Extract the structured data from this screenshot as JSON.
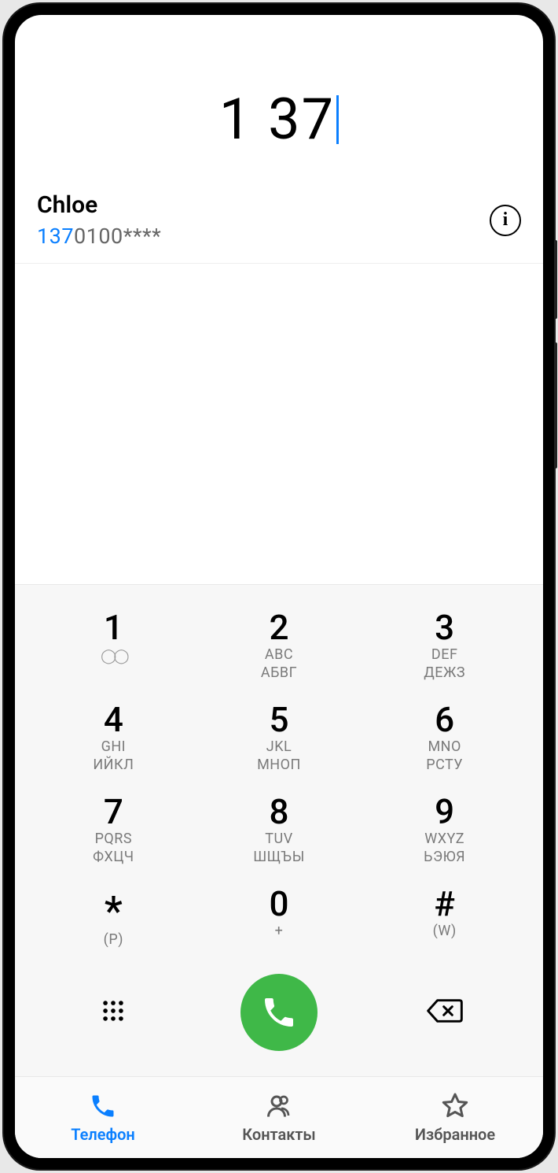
{
  "dialed_number": "1 37",
  "suggestion": {
    "name": "Chloe",
    "number_match": "137",
    "number_rest": "0100****"
  },
  "keys": [
    {
      "digit": "1",
      "sub1": "",
      "sub2": "",
      "voicemail": true
    },
    {
      "digit": "2",
      "sub1": "ABC",
      "sub2": "АБВГ"
    },
    {
      "digit": "3",
      "sub1": "DEF",
      "sub2": "ДЕЖЗ"
    },
    {
      "digit": "4",
      "sub1": "GHI",
      "sub2": "ИЙКЛ"
    },
    {
      "digit": "5",
      "sub1": "JKL",
      "sub2": "МНОП"
    },
    {
      "digit": "6",
      "sub1": "MNO",
      "sub2": "РСТУ"
    },
    {
      "digit": "7",
      "sub1": "PQRS",
      "sub2": "ФХЦЧ"
    },
    {
      "digit": "8",
      "sub1": "TUV",
      "sub2": "ШЩЪЫ"
    },
    {
      "digit": "9",
      "sub1": "WXYZ",
      "sub2": "ЬЭЮЯ"
    },
    {
      "digit": "*",
      "sub1": "(P)",
      "sub2": ""
    },
    {
      "digit": "0",
      "sub1": "+",
      "sub2": ""
    },
    {
      "digit": "#",
      "sub1": "(W)",
      "sub2": ""
    }
  ],
  "nav": {
    "phone": "Телефон",
    "contacts": "Контакты",
    "favorites": "Избранное"
  },
  "colors": {
    "accent": "#0a7fff",
    "call": "#3fb848"
  }
}
